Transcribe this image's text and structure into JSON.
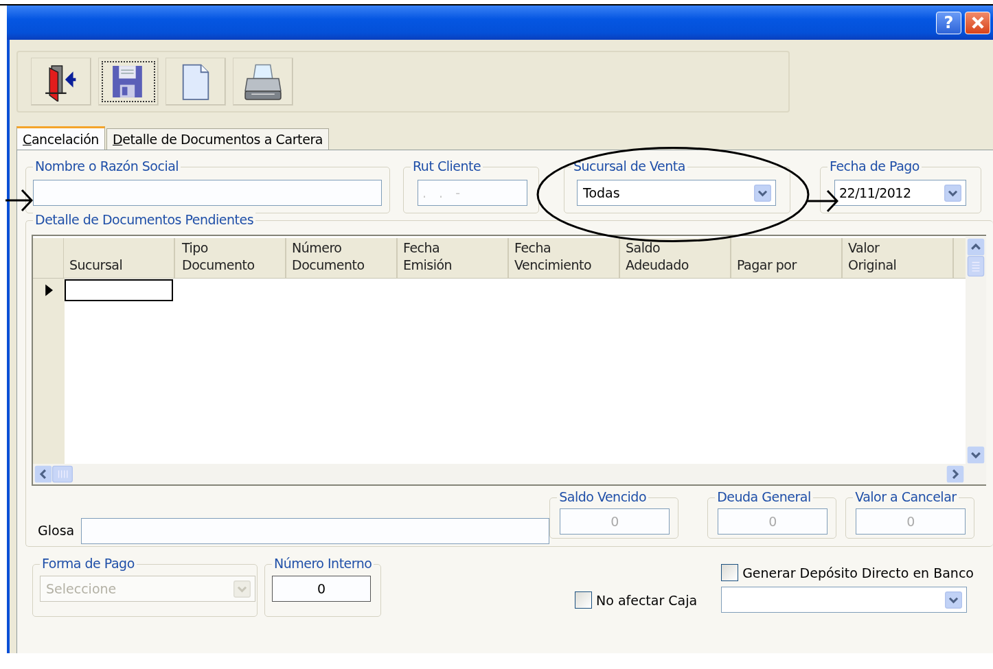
{
  "window": {
    "controls": [
      {
        "kind": "help",
        "text": "?"
      },
      {
        "kind": "close"
      }
    ]
  },
  "toolbar": [
    {
      "kind": "exit",
      "focused": false
    },
    {
      "kind": "save",
      "focused": true
    },
    {
      "kind": "new",
      "focused": false
    },
    {
      "kind": "print",
      "focused": false
    }
  ],
  "tabs": [
    {
      "label": "Cancelación",
      "selected": true
    },
    {
      "label": "Detalle de Documentos a Cartera",
      "selected": false
    }
  ],
  "filters": [
    {
      "kind": "text",
      "label": "Nombre o Razón Social"
    },
    {
      "kind": "masked",
      "label": "Rut Cliente",
      "value": ". . -"
    },
    {
      "kind": "combo",
      "label": "Sucursal de Venta",
      "value": "Todas"
    },
    {
      "kind": "combo",
      "label": "Fecha de Pago",
      "value": "22/11/2012"
    }
  ],
  "grid": {
    "title": "Detalle de Documentos Pendientes",
    "columns": [
      {
        "lines": [
          "Sucursal"
        ]
      },
      {
        "lines": [
          "Tipo",
          "Documento"
        ]
      },
      {
        "lines": [
          "Número",
          "Documento"
        ]
      },
      {
        "lines": [
          "Fecha",
          "Emisión"
        ]
      },
      {
        "lines": [
          "Fecha",
          "Vencimiento"
        ]
      },
      {
        "lines": [
          "Saldo",
          "Adeudado"
        ]
      },
      {
        "lines": [
          "Pagar por"
        ]
      },
      {
        "lines": [
          "Valor",
          "Original"
        ]
      }
    ],
    "rows": [
      {
        "current": true
      }
    ]
  },
  "glosa": {
    "label": "Glosa"
  },
  "totals": [
    {
      "label": "Saldo Vencido",
      "value": "0"
    },
    {
      "label": "Deuda General",
      "value": "0"
    },
    {
      "label": "Valor a Cancelar",
      "value": "0"
    }
  ],
  "forma_pago": {
    "label": "Forma de Pago",
    "placeholder": "Seleccione",
    "disabled": true
  },
  "numero_interno": {
    "label": "Número Interno",
    "value": "0"
  },
  "checkboxes": [
    {
      "label": "No afectar Caja",
      "checked": false
    },
    {
      "label": "Generar Depósito Directo en Banco",
      "checked": false
    }
  ]
}
